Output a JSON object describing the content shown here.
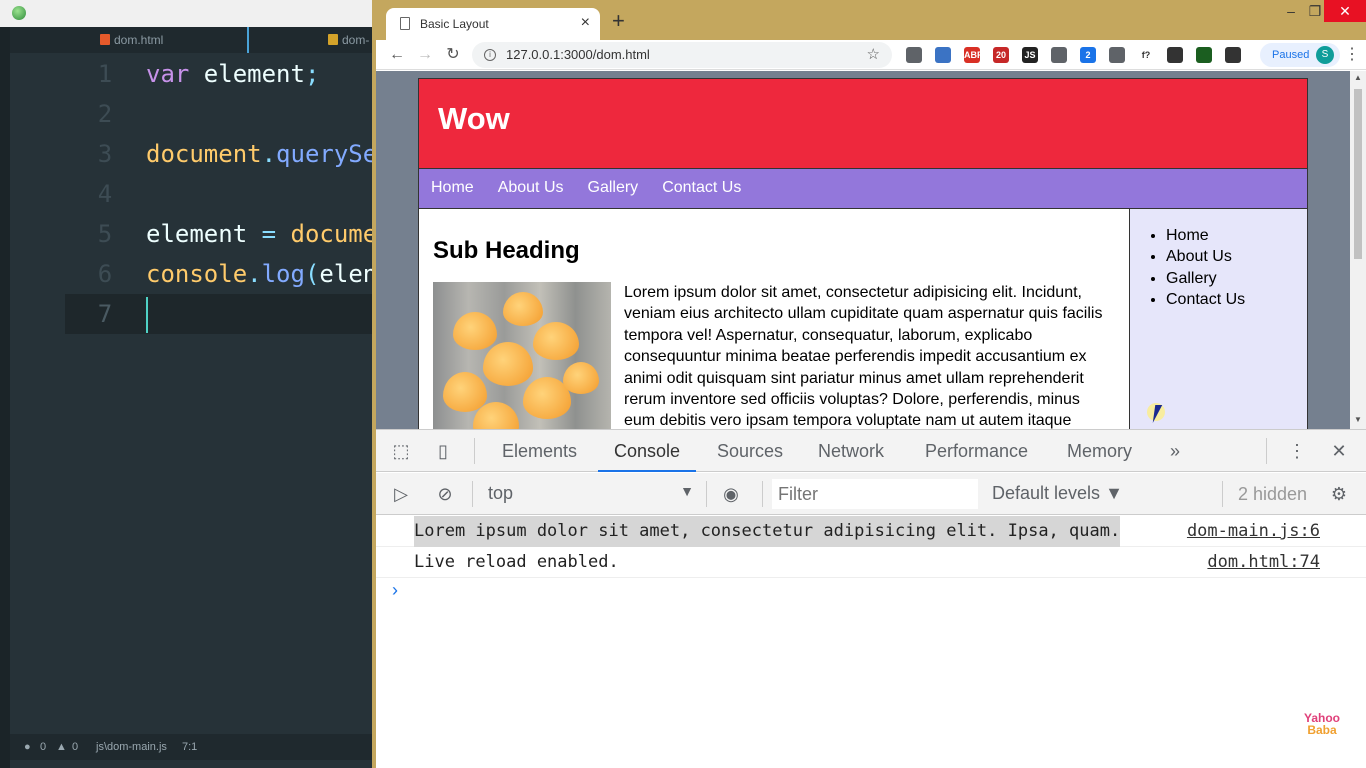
{
  "editor": {
    "tabs": [
      "dom.html",
      "dom-"
    ],
    "lines": [
      {
        "n": "1"
      },
      {
        "n": "2"
      },
      {
        "n": "3"
      },
      {
        "n": "4"
      },
      {
        "n": "5"
      },
      {
        "n": "6"
      },
      {
        "n": "7"
      }
    ],
    "code": {
      "l1_kw": "var",
      "l1_id": " element",
      "l1_pu": ";",
      "l3_gl": "document",
      "l3_pu": ".",
      "l3_fn": "querySe",
      "l5_id": "element ",
      "l5_pu": "=",
      "l5_gl": " docume",
      "l6_gl": "console",
      "l6_pu": ".",
      "l6_fn": "log",
      "l6_pu2": "(",
      "l6_id": "elen"
    },
    "status": {
      "errors": "0",
      "warnings": "0",
      "file": "js\\dom-main.js",
      "pos": "7:1"
    }
  },
  "browser": {
    "tab_title": "Basic Layout",
    "url": "127.0.0.1:3000/dom.html",
    "profile_status": "Paused",
    "profile_initial": "S",
    "extensions": [
      {
        "label": "",
        "color": "#5f6368"
      },
      {
        "label": "",
        "color": "#3b73c4"
      },
      {
        "label": "ABP",
        "color": "#d93025"
      },
      {
        "label": "20",
        "color": "#c62828"
      },
      {
        "label": "JS",
        "color": "#222222"
      },
      {
        "label": "",
        "color": "#5f6368"
      },
      {
        "label": "2",
        "color": "#1a73e8"
      },
      {
        "label": "",
        "color": "#5f6368"
      },
      {
        "label": "f?",
        "color": "#ffffff"
      },
      {
        "label": "",
        "color": "#333333"
      },
      {
        "label": "",
        "color": "#1b5e20"
      },
      {
        "label": "",
        "color": "#333333"
      }
    ]
  },
  "site": {
    "header": "Wow",
    "nav": [
      "Home",
      "About Us",
      "Gallery",
      "Contact Us"
    ],
    "sub_heading": "Sub Heading",
    "paragraph": "Lorem ipsum dolor sit amet, consectetur adipisicing elit. Incidunt, veniam eius architecto ullam cupiditate quam aspernatur quis facilis tempora vel! Aspernatur, consequatur, laborum, explicabo consequuntur minima beatae perferendis impedit accusantium ex animi odit quisquam sint pariatur minus amet ullam reprehenderit rerum inventore sed officiis voluptas? Dolore, perferendis, minus eum debitis vero ipsam tempora voluptate nam ut autem itaque",
    "aside": [
      "Home",
      "About Us",
      "Gallery",
      "Contact Us"
    ]
  },
  "devtools": {
    "tabs": [
      "Elements",
      "Console",
      "Sources",
      "Network",
      "Performance",
      "Memory"
    ],
    "active_tab": "Console",
    "context": "top",
    "filter_placeholder": "Filter",
    "levels": "Default levels",
    "hidden": "2 hidden",
    "messages": [
      {
        "text": "Lorem ipsum dolor sit amet, consectetur adipisicing elit. Ipsa, quam.",
        "source": "dom-main.js:6"
      },
      {
        "text": "Live reload enabled.",
        "source": "dom.html:74"
      }
    ],
    "prompt": "›"
  },
  "watermark": {
    "line1": "Yahoo",
    "line2": "Baba"
  },
  "colors": {
    "site_header": "#ee283d",
    "site_nav": "#9377db",
    "aside_bg": "#e6e6fa",
    "editor_bg": "#263238",
    "accent": "#1a73e8"
  }
}
